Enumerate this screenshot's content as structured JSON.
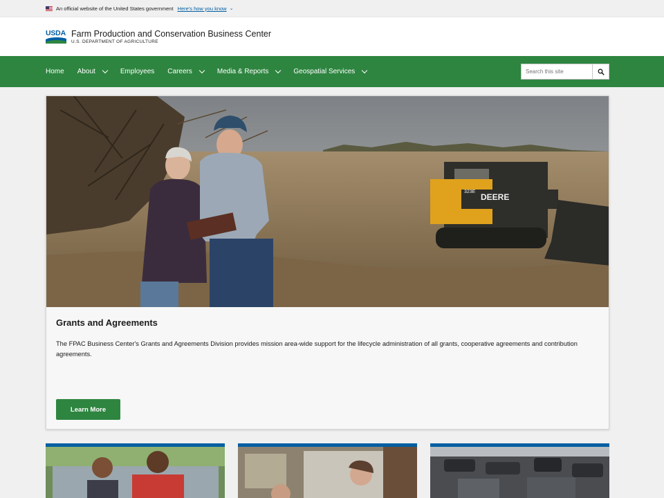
{
  "gov_banner": {
    "text": "An official website of the United States government",
    "link": "Here's how you know"
  },
  "header": {
    "logo_text": "USDA",
    "title": "Farm Production and Conservation Business Center",
    "subtitle": "U.S. DEPARTMENT OF AGRICULTURE"
  },
  "nav": {
    "items": [
      {
        "label": "Home",
        "dropdown": false
      },
      {
        "label": "About",
        "dropdown": true
      },
      {
        "label": "Employees",
        "dropdown": false
      },
      {
        "label": "Careers",
        "dropdown": true
      },
      {
        "label": "Media & Reports",
        "dropdown": true
      },
      {
        "label": "Geospatial Services",
        "dropdown": true
      }
    ],
    "search_placeholder": "Search this site"
  },
  "hero": {
    "title": "Grants and Agreements",
    "body": "The FPAC Business Center's Grants and Agreements Division provides mission area-wide support for the lifecycle administration of all grants, cooperative agreements and contribution agreements.",
    "button": "Learn More",
    "machine_brand": "DEERE",
    "machine_model": "323E"
  },
  "colors": {
    "primary_green": "#2e8540",
    "link_blue": "#005ea2",
    "card_top_border": "#005ea2"
  }
}
